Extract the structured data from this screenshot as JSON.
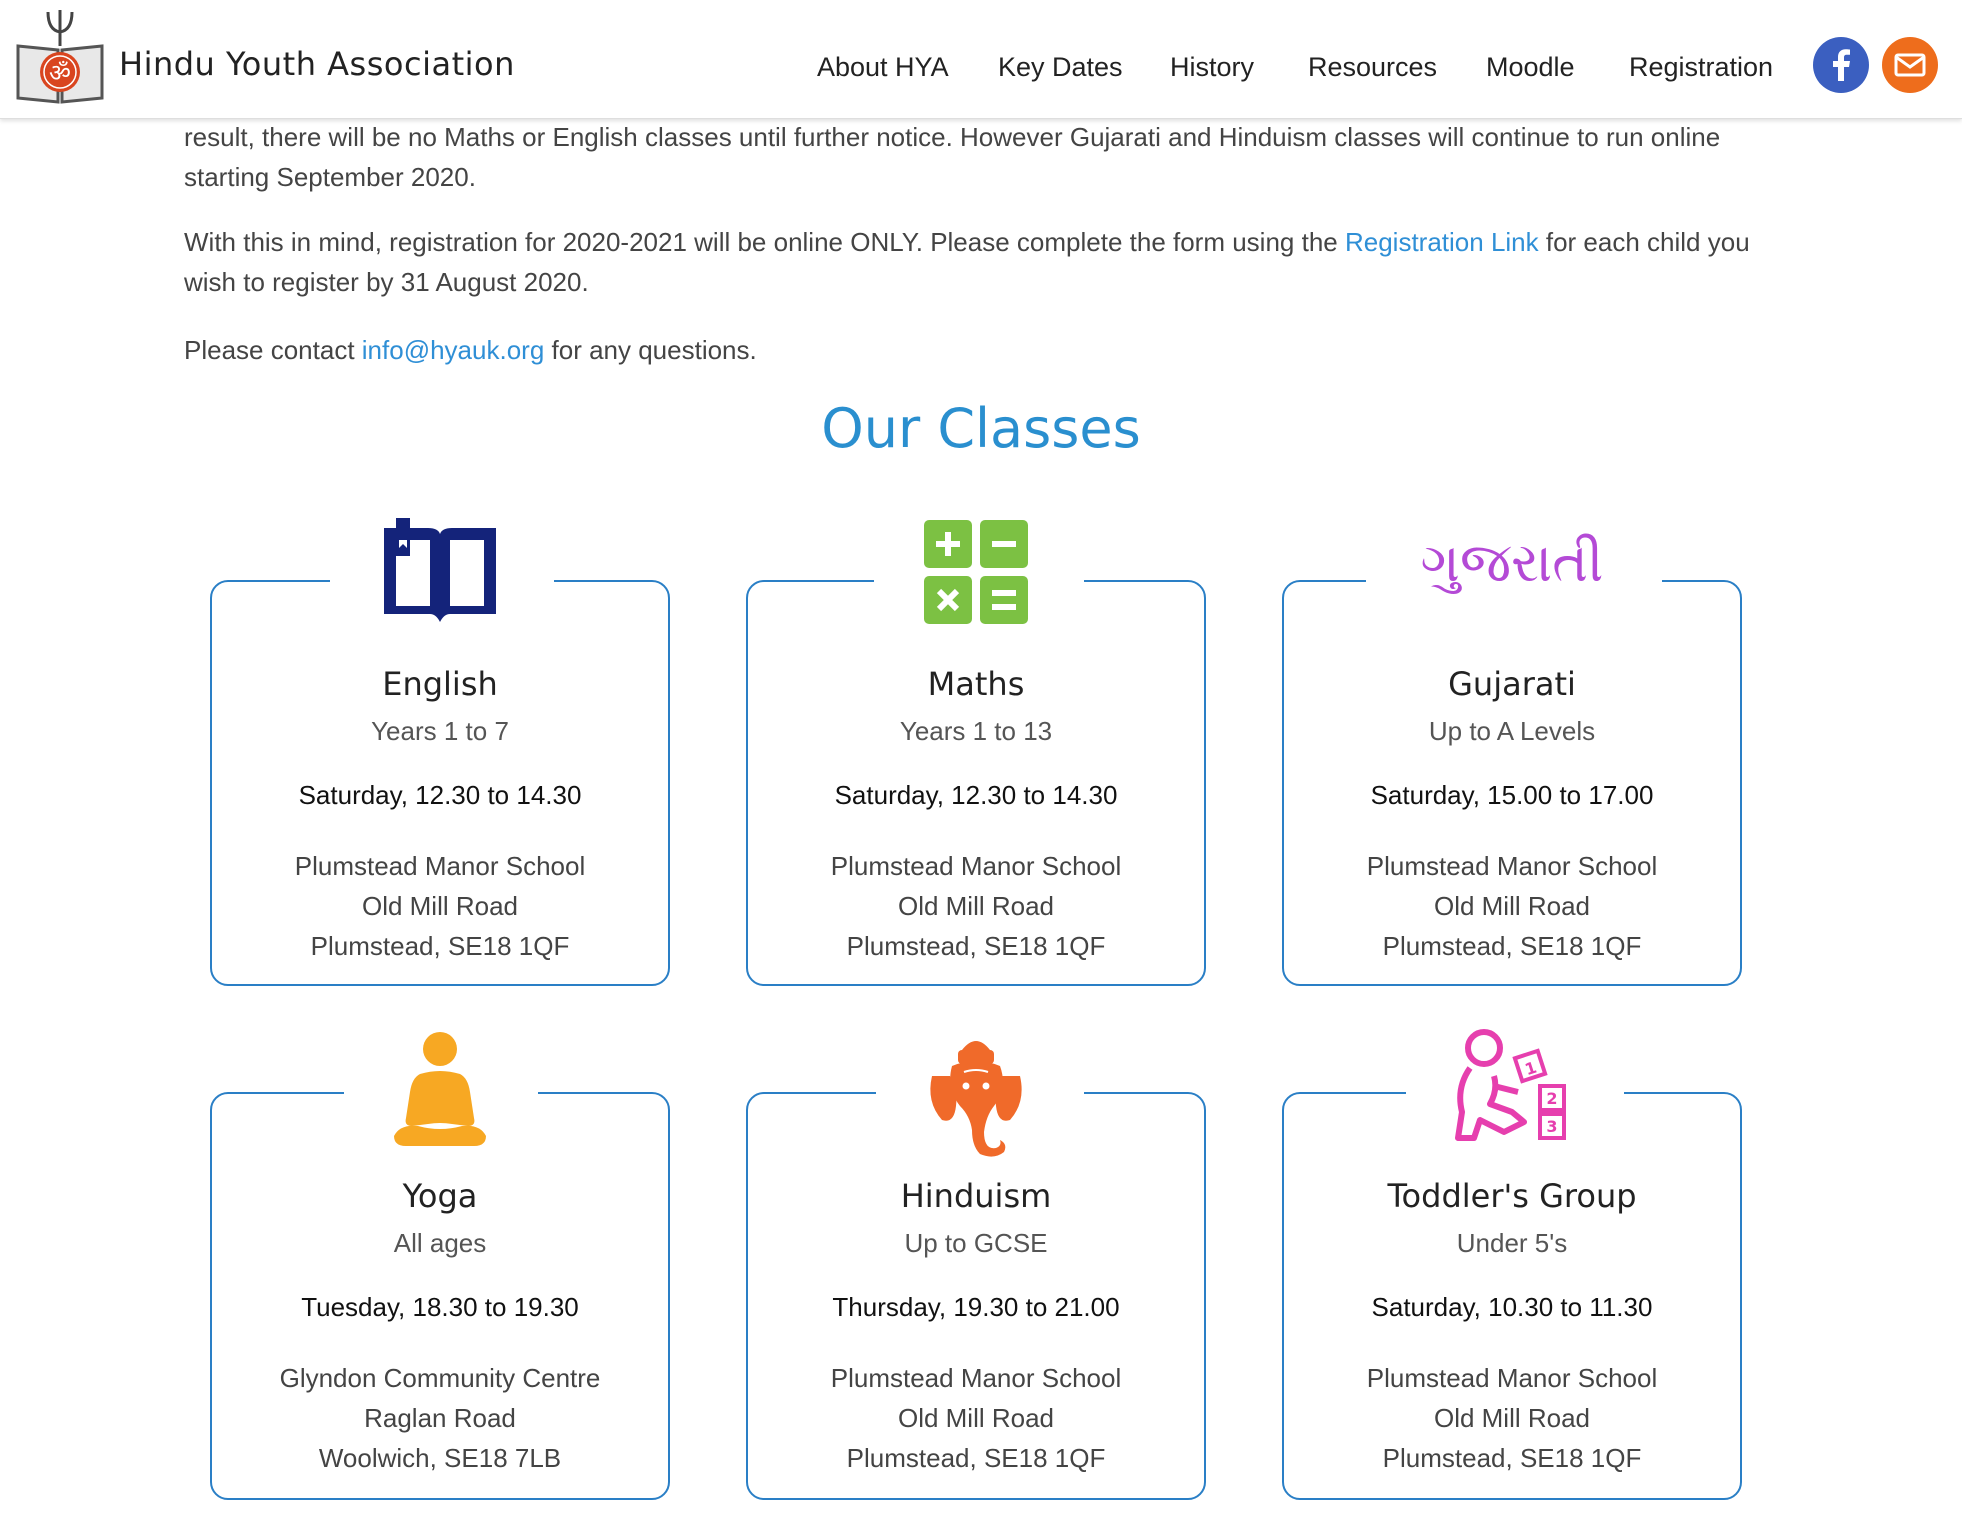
{
  "header": {
    "brand": "Hindu Youth Association",
    "nav": [
      {
        "label": "About HYA"
      },
      {
        "label": "Key Dates"
      },
      {
        "label": "History"
      },
      {
        "label": "Resources"
      },
      {
        "label": "Moodle"
      },
      {
        "label": "Registration"
      }
    ],
    "social": {
      "facebook_icon": "facebook-icon",
      "mail_icon": "mail-icon"
    }
  },
  "intro": {
    "p1": "result, there will be no Maths or English classes until further notice. However Gujarati and Hinduism classes will continue to run online starting September 2020.",
    "p2_before": "With this in mind, registration for 2020-2021 will be online ONLY. Please complete the form using the ",
    "p2_link": "Registration Link",
    "p2_after": " for each child you wish to register by 31 August 2020.",
    "p3_before": "Please contact ",
    "p3_link": "info@hyauk.org",
    "p3_after": " for any questions."
  },
  "section_title": "Our Classes",
  "classes": [
    {
      "title": "English",
      "sub": "Years 1 to 7",
      "time": "Saturday, 12.30 to 14.30",
      "addr": [
        "Plumstead Manor School",
        "Old Mill Road",
        "Plumstead, SE18 1QF"
      ],
      "icon": "book-icon"
    },
    {
      "title": "Maths",
      "sub": "Years 1 to 13",
      "time": "Saturday, 12.30 to 14.30",
      "addr": [
        "Plumstead Manor School",
        "Old Mill Road",
        "Plumstead, SE18 1QF"
      ],
      "icon": "calculator-icon"
    },
    {
      "title": "Gujarati",
      "sub": "Up to A Levels",
      "time": "Saturday, 15.00 to 17.00",
      "addr": [
        "Plumstead Manor School",
        "Old Mill Road",
        "Plumstead, SE18 1QF"
      ],
      "icon": "gujarati-script-icon",
      "icon_text": "ગુજરાતી"
    },
    {
      "title": "Yoga",
      "sub": "All ages",
      "time": "Tuesday, 18.30 to 19.30",
      "addr": [
        "Glyndon Community Centre",
        "Raglan Road",
        "Woolwich, SE18 7LB"
      ],
      "icon": "meditation-icon"
    },
    {
      "title": "Hinduism",
      "sub": "Up to GCSE",
      "time": "Thursday, 19.30 to 21.00",
      "addr": [
        "Plumstead Manor School",
        "Old Mill Road",
        "Plumstead, SE18 1QF"
      ],
      "icon": "ganesha-icon"
    },
    {
      "title": "Toddler's Group",
      "sub": "Under 5's",
      "time": "Saturday, 10.30 to 11.30",
      "addr": [
        "Plumstead Manor School",
        "Old Mill Road",
        "Plumstead, SE18 1QF"
      ],
      "icon": "toddler-blocks-icon"
    }
  ],
  "colors": {
    "accent": "#2a8fcf",
    "card_border": "#2a7fc6",
    "book": "#14237a",
    "calculator": "#7cc143",
    "gujarati": "#b44ad6",
    "yoga": "#f7a823",
    "ganesha": "#f06a2a",
    "toddler": "#e63fae"
  }
}
